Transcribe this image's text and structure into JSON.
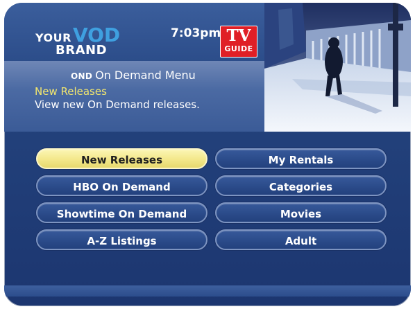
{
  "brand": {
    "your": "YOUR",
    "vod": "VOD",
    "brand": "BRAND"
  },
  "clock": "7:03pm",
  "tv_guide": {
    "tv": "TV",
    "guide": "GUIDE"
  },
  "info": {
    "ond_label": "OND",
    "menu_title": "On Demand Menu",
    "selected_title": "New Releases",
    "selected_description": "View new On Demand releases."
  },
  "menu": {
    "left": [
      "New Releases",
      "HBO On Demand",
      "Showtime On Demand",
      "A-Z Listings"
    ],
    "right": [
      "My Rentals",
      "Categories",
      "Movies",
      "Adult"
    ],
    "selected": "New Releases"
  },
  "colors": {
    "background": "#22407a",
    "selected_button": "#f3e78a",
    "highlight_text": "#f2e66e",
    "tv_guide_red": "#e01f26",
    "vod_blue": "#3fa0e0"
  }
}
